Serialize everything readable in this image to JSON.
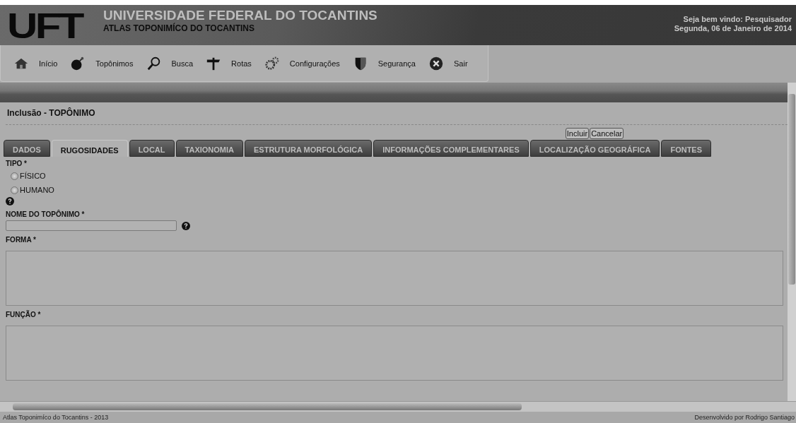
{
  "header": {
    "logo": "UFT",
    "title": "UNIVERSIDADE FEDERAL DO TOCANTINS",
    "subtitle": "ATLAS TOPONIMÍCO DO TOCANTINS",
    "welcome": "Seja bem vindo: Pesquisador",
    "date": "Segunda, 06 de Janeiro de 2014"
  },
  "menu": [
    {
      "label": "Início"
    },
    {
      "label": "Topônimos"
    },
    {
      "label": "Busca"
    },
    {
      "label": "Rotas"
    },
    {
      "label": "Configurações"
    },
    {
      "label": "Segurança"
    },
    {
      "label": "Sair"
    }
  ],
  "page_title": "Inclusão - TOPÔNIMO",
  "buttons": [
    "Incluir",
    "Cancelar"
  ],
  "tabs": [
    {
      "label": "DADOS",
      "selected": false
    },
    {
      "label": "RUGOSIDADES",
      "selected": true
    },
    {
      "label": "LOCAL",
      "selected": false
    },
    {
      "label": "TAXIONOMIA",
      "selected": false
    },
    {
      "label": "ESTRUTURA MORFOLÓGICA",
      "selected": false
    },
    {
      "label": "INFORMAÇÕES COMPLEMENTARES",
      "selected": false
    },
    {
      "label": "LOCALIZAÇÃO GEOGRÁFICA",
      "selected": false
    },
    {
      "label": "FONTES",
      "selected": false
    }
  ],
  "tipo": {
    "label": "TIPO *",
    "options": [
      {
        "label": "FÍSICO",
        "checked": false
      },
      {
        "label": "HUMANO",
        "checked": false
      }
    ]
  },
  "fields": [
    {
      "label": "NOME DO TOPÔNIMO *",
      "kind": "input"
    },
    {
      "label": "FORMA *",
      "kind": "textarea"
    },
    {
      "label": "FUNÇÃO *",
      "kind": "textarea"
    }
  ],
  "footer": {
    "left": "Atlas Toponimíco do Tocantins - 2013",
    "right": "Desenvolvido por Rodrigo Santiago"
  }
}
